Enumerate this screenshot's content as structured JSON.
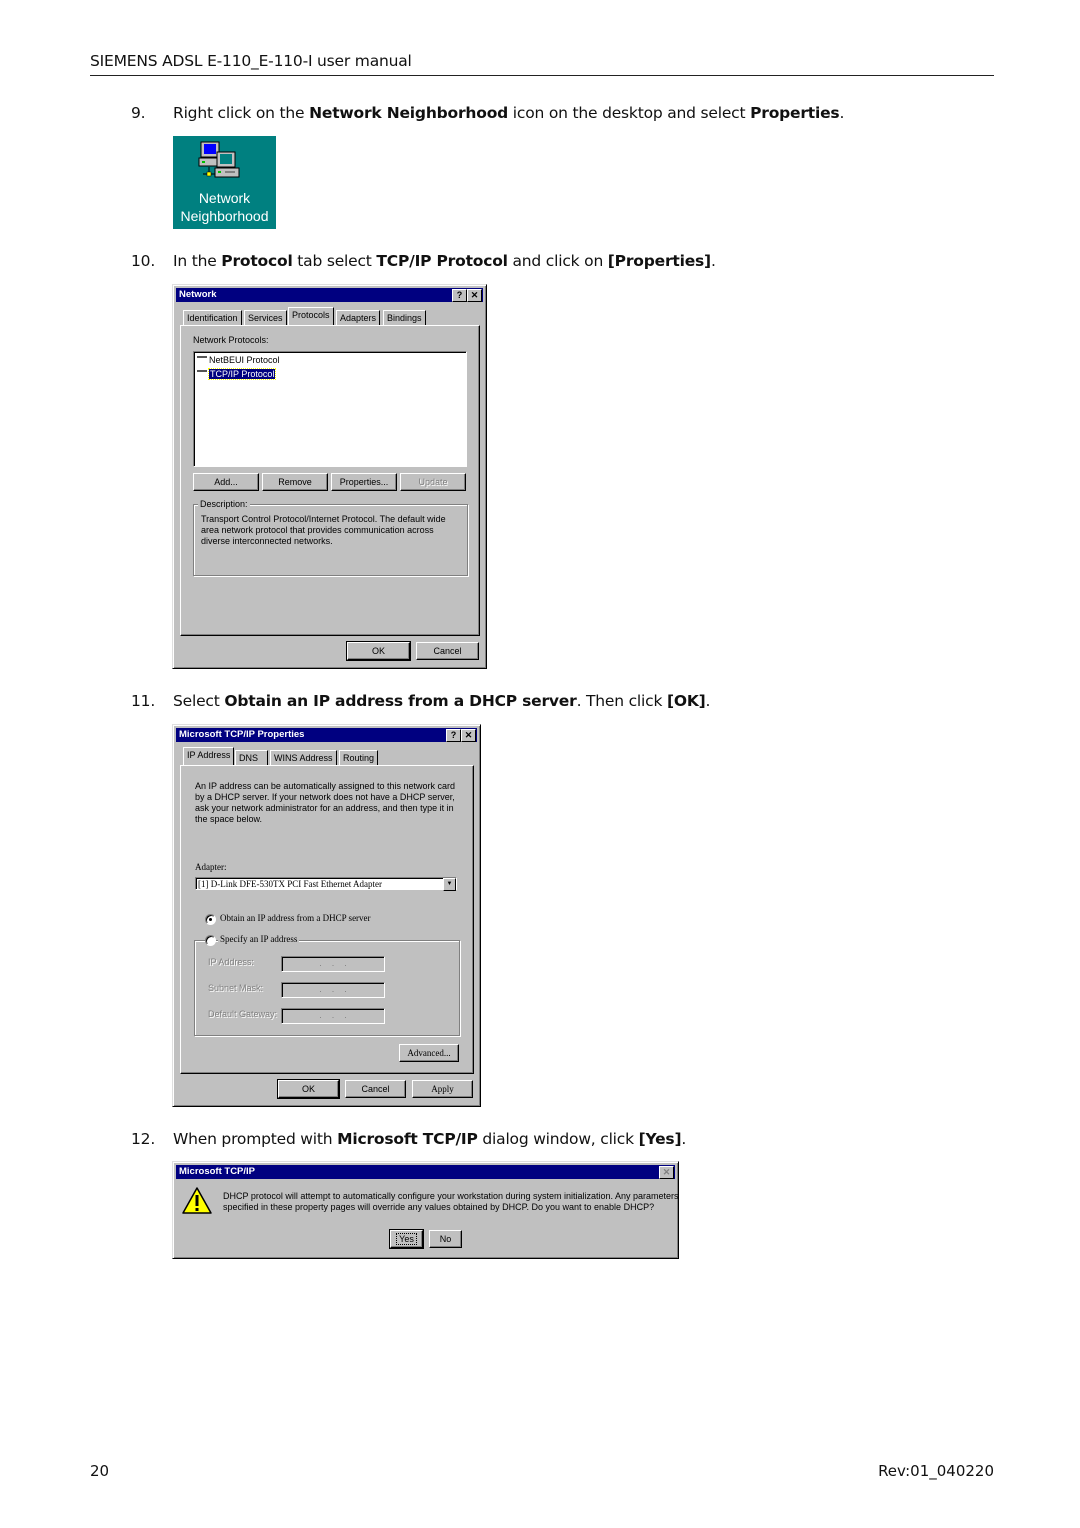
{
  "header": {
    "title": "SIEMENS ADSL E-110_E-110-I user manual"
  },
  "steps": [
    {
      "num": "9.",
      "pre": "Right click on the ",
      "b1": "Network Neighborhood",
      "mid": " icon on the desktop and select ",
      "b2": "Properties",
      "post": "."
    },
    {
      "num": "10.",
      "pre": "In the ",
      "b1": "Protocol",
      "mid": " tab select ",
      "b2": "TCP/IP Protocol",
      "mid2": " and click on ",
      "b3": "[Properties]",
      "post": "."
    },
    {
      "num": "11.",
      "pre": "Select ",
      "b1": "Obtain an IP address from a DHCP server",
      "mid": ". Then click ",
      "b2": "[OK]",
      "post": "."
    },
    {
      "num": "12.",
      "pre": "When prompted with ",
      "b1": "Microsoft TCP/IP",
      "mid": " dialog window, click ",
      "b2": "[Yes]",
      "post": "."
    }
  ],
  "desktop_icon": {
    "line1": "Network",
    "line2": "Neighborhood",
    "icon": "network-computers-icon"
  },
  "network_dialog": {
    "title": "Network",
    "help": "?",
    "close": "✕",
    "tabs": [
      "Identification",
      "Services",
      "Protocols",
      "Adapters",
      "Bindings"
    ],
    "active_tab": "Protocols",
    "list_label": "Network Protocols:",
    "protocols": [
      "NetBEUI Protocol",
      "TCP/IP Protocol"
    ],
    "selected_protocol": "TCP/IP Protocol",
    "buttons": {
      "add": "Add...",
      "remove": "Remove",
      "properties": "Properties...",
      "update": "Update"
    },
    "description_label": "Description:",
    "description": "Transport Control Protocol/Internet Protocol. The default wide area network protocol that provides communication across diverse interconnected networks.",
    "ok": "OK",
    "cancel": "Cancel"
  },
  "tcpip_dialog": {
    "title": "Microsoft TCP/IP Properties",
    "help": "?",
    "close": "✕",
    "tabs": [
      "IP Address",
      "DNS",
      "WINS Address",
      "Routing"
    ],
    "active_tab": "IP Address",
    "intro": "An IP address can be automatically assigned to this network card by a DHCP server.  If your network does not have a DHCP server, ask your network administrator for an address, and then type it in the space below.",
    "adapter_label": "Adapter:",
    "adapter_value": "[1] D-Link DFE-530TX PCI Fast Ethernet Adapter",
    "radio_obtain": "Obtain an IP address from a DHCP server",
    "radio_specify": "Specify an IP address",
    "selected_radio": "obtain",
    "ip_label": "IP Address:",
    "subnet_label": "Subnet Mask:",
    "gateway_label": "Default Gateway:",
    "ip_value": " .    .    . ",
    "subnet_value": " .    .    . ",
    "gateway_value": " .    .    . ",
    "advanced": "Advanced...",
    "ok": "OK",
    "cancel": "Cancel",
    "apply": "Apply"
  },
  "confirm_dialog": {
    "title": "Microsoft TCP/IP",
    "close": "✕",
    "icon": "warning-icon",
    "message_line1": "DHCP protocol will attempt to automatically configure your workstation during system initialization. Any parameters",
    "message_line2": "specified in these property pages will override any values obtained by DHCP.  Do you want to enable DHCP?",
    "yes": "Yes",
    "no": "No"
  },
  "footer": {
    "page": "20",
    "revision": "Rev:01_040220"
  }
}
